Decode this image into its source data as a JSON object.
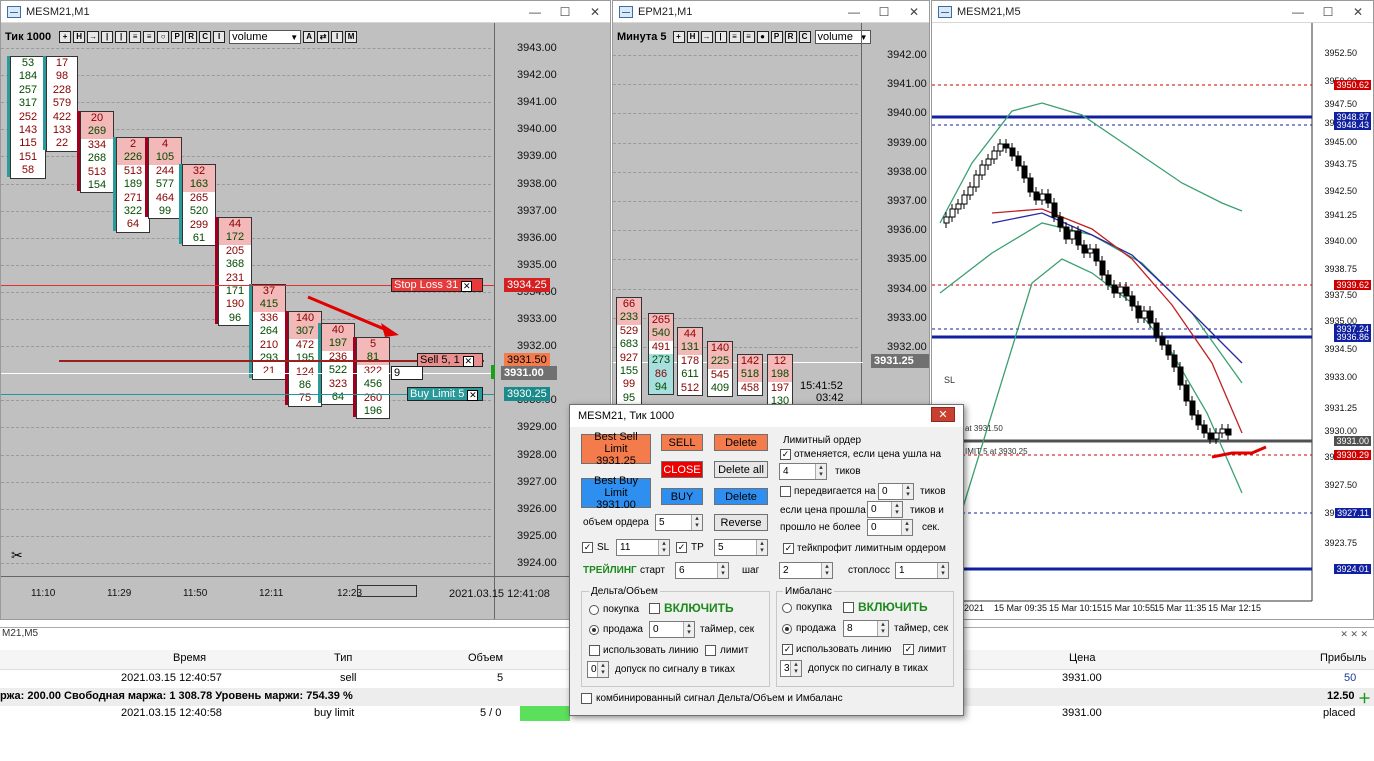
{
  "win1": {
    "title": "MESM21,M1",
    "toolbar": {
      "label": "Тик  1000",
      "buttons": [
        "+",
        "H",
        "+",
        "I",
        "I",
        "E",
        "E",
        "O",
        "P",
        "R",
        "C",
        "I"
      ],
      "select": "volume",
      "btns2": [
        "A",
        "+",
        "I",
        "M"
      ]
    },
    "prices": [
      "3943.00",
      "3942.00",
      "3941.00",
      "3940.00",
      "3939.00",
      "3938.00",
      "3937.00",
      "3936.00",
      "3935.00",
      "3934.00",
      "3933.00",
      "3932.00",
      "3931.00",
      "3930.00",
      "3929.00",
      "3928.00",
      "3927.00",
      "3926.00",
      "3925.00",
      "3924.00"
    ],
    "times": [
      "11:10",
      "11:29",
      "11:50",
      "12:11",
      "12:23"
    ],
    "datetime": "2021.03.15 12:41:08",
    "stop_loss": {
      "label": "Stop Loss  31",
      "price": "3934.25"
    },
    "sell_order": {
      "label": "Sell  5,  1",
      "price": "3931.50"
    },
    "buy_limit": {
      "label": "Buy Limit  5",
      "price": "3930.25"
    },
    "current_price": "3931.00",
    "clock": "15:41:52",
    "small_box": "9",
    "clusters": [
      {
        "col1": [
          "53",
          "184",
          "257",
          "317",
          "252",
          "143",
          "115",
          "151",
          "58"
        ],
        "col2": [
          "17",
          "98",
          "228",
          "579",
          "422",
          "133",
          "22"
        ]
      },
      {
        "col1": [
          "20",
          "269",
          "334",
          "268",
          "513",
          "154"
        ]
      },
      {
        "col1": [
          "2",
          "226",
          "513",
          "189",
          "271",
          "322",
          "64"
        ]
      },
      {
        "col1": [
          "4",
          "105",
          "244",
          "577",
          "464",
          "99"
        ]
      },
      {
        "col1": [
          "32",
          "163",
          "265",
          "520",
          "299",
          "61"
        ]
      },
      {
        "col1": [
          "44",
          "172",
          "205",
          "368",
          "231",
          "171",
          "190",
          "96"
        ]
      },
      {
        "col1": [
          "37",
          "415",
          "336",
          "264",
          "210",
          "293",
          "21"
        ]
      },
      {
        "col1": [
          "140",
          "307",
          "472",
          "195",
          "124",
          "86",
          "75"
        ]
      },
      {
        "col1": [
          "40",
          "197",
          "236",
          "522",
          "323",
          "64"
        ]
      },
      {
        "col1": [
          "5",
          "81",
          "322",
          "456",
          "260",
          "196"
        ]
      }
    ]
  },
  "win2": {
    "title": "EPM21,M1",
    "toolbar": {
      "label": "Минута  5",
      "select": "volume"
    },
    "prices": [
      "3942.00",
      "3941.00",
      "3940.00",
      "3939.00",
      "3938.00",
      "3937.00",
      "3936.00",
      "3935.00",
      "3934.00",
      "3933.00",
      "3932.00"
    ],
    "current_price": "3931.25",
    "clock": "15:41:52",
    "clock2": "03:42",
    "clusters": [
      {
        "col1": [
          "66",
          "233",
          "529",
          "683",
          "927",
          "155",
          "99",
          "95"
        ]
      },
      {
        "col1": [
          "265",
          "540",
          "491",
          "273",
          "86",
          "94"
        ]
      },
      {
        "col1": [
          "44",
          "131",
          "178",
          "611",
          "512"
        ]
      },
      {
        "col1": [
          "140",
          "225",
          "545",
          "409"
        ]
      },
      {
        "col1": [
          "142",
          "518",
          "458"
        ]
      },
      {
        "col1": [
          "12",
          "198",
          "197",
          "130"
        ]
      }
    ]
  },
  "win3": {
    "title": "MESM21,M5",
    "prices": [
      "3952.50",
      "3950.00",
      "3947.50",
      "3946.25",
      "3945.00",
      "3943.75",
      "3942.50",
      "3941.25",
      "3940.00",
      "3938.75",
      "3937.50",
      "3935.00",
      "3934.50",
      "3933.00",
      "3931.25",
      "3930.00",
      "3928.50",
      "3927.50",
      "3925.00",
      "3923.75"
    ],
    "tags": [
      {
        "text": "3950.62",
        "color": "#d00000"
      },
      {
        "text": "3948.87",
        "color": "#1020a0"
      },
      {
        "text": "3948.43",
        "color": "#1020a0"
      },
      {
        "text": "3939.62",
        "color": "#d00000"
      },
      {
        "text": "3937.24",
        "color": "#1020a0"
      },
      {
        "text": "3936.86",
        "color": "#1020a0"
      },
      {
        "text": "3931.00",
        "color": "#505050"
      },
      {
        "text": "3930.29",
        "color": "#d00000"
      },
      {
        "text": "3927.11",
        "color": "#1020a0"
      },
      {
        "text": "3924.01",
        "color": "#1020a0"
      }
    ],
    "labels": {
      "sl": "SL",
      "at1": "at 3931.50",
      "at2": "IMIT 5 at 3930.25"
    },
    "times": [
      "2021",
      "15 Mar 09:35",
      "15 Mar 10:15",
      "15 Mar 10:55",
      "15 Mar 11:35",
      "15 Mar 12:15"
    ]
  },
  "dialog": {
    "title": "MESM21, Тик  1000",
    "close": "✕",
    "best_sell": "Best Sell Limit\n3931.25",
    "best_buy": "Best Buy Limit\n3931.00",
    "sell": "SELL",
    "close_btn": "CLOSE",
    "buy": "BUY",
    "delete": "Delete",
    "delete_all": "Delete all",
    "delete2": "Delete",
    "reverse": "Reverse",
    "order_volume_label": "объем ордера",
    "order_volume": "5",
    "sl_label": "SL",
    "sl_value": "11",
    "tp_label": "TP",
    "tp_value": "5",
    "trailing_label": "ТРЕЙЛИНГ",
    "start_label": "старт",
    "start_value": "6",
    "step_label": "шаг",
    "step_value": "2",
    "stoploss_label": "стоплосс",
    "stoploss_value": "1",
    "limit_order_title": "Лимитный ордер",
    "cancel_if_label": "отменяется, если цена ушла на",
    "cancel_ticks": "4",
    "ticks_label": "тиков",
    "moves_label": "передвигается на",
    "moves_value": "0",
    "ticks_label2": "тиков",
    "if_passed_label": "если цена прошла",
    "if_passed_value": "0",
    "ticks_and_label": "тиков и",
    "no_more_label": "прошло не более",
    "no_more_value": "0",
    "sec_label": "сек.",
    "takeprofit_label": "тейкпрофит лимитным ордером",
    "delta_title": "Дельта/Объем",
    "imbalance_title": "Имбаланс",
    "buy_label": "покупка",
    "sell_label": "продажа",
    "enable_label": "ВКЛЮЧИТЬ",
    "timer_label": "таймер, сек",
    "delta_timer": "0",
    "imb_timer": "8",
    "use_line_label": "использовать линию",
    "limit_label": "лимит",
    "tolerance_label": "допуск по сигналу в тиках",
    "delta_tol": "0",
    "imb_tol": "3",
    "combined_label": "комбинированный сигнал Дельта/Объем и Имбаланс"
  },
  "bottom": {
    "panel_title": "M21,M5",
    "headers": {
      "time": "Время",
      "type": "Тип",
      "volume": "Объем",
      "price": "Цена",
      "profit": "Прибыль"
    },
    "row1": {
      "time": "2021.03.15 12:40:57",
      "type": "sell",
      "volume": "5",
      "price": "3931.00",
      "profit": "50"
    },
    "margin": "ржа: 200.00  Свободная маржа: 1 308.78  Уровень маржи: 754.39 %",
    "margin_profit": "12.50",
    "row2": {
      "time": "2021.03.15 12:40:58",
      "type": "buy limit",
      "volume": "5 / 0",
      "price": "3931.00",
      "profit": "placed"
    }
  }
}
